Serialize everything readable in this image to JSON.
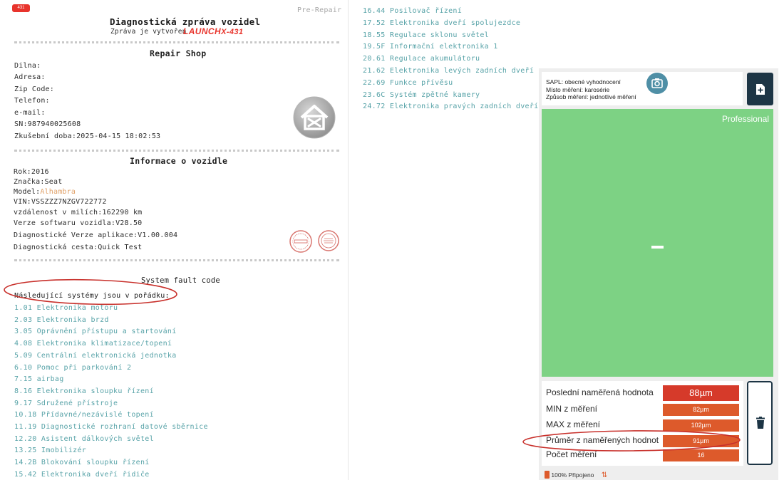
{
  "app_badge": "431",
  "report": {
    "pre_repair": "Pre-Repair",
    "title": "Diagnostická zpráva vozidel",
    "subtitle": "Zpráva je vytvořen",
    "brand_launch": "LAUNCH",
    "brand_x431": "X-431",
    "shop": {
      "heading": "Repair Shop",
      "dilna": "Dilna:",
      "adresa": "Adresa:",
      "zip": "Zip Code:",
      "telefon": "Telefon:",
      "email": "e-mail:",
      "sn": "SN:987940025608",
      "test_time": "Zkušební doba:2025-04-15 18:02:53"
    },
    "vehicle": {
      "heading": "Informace o vozidle",
      "year": "Rok:2016",
      "make": "Značka:Seat",
      "model_label": "Model:",
      "model_value": "Alhambra",
      "vin": "VIN:VSSZZZ7NZGV722772",
      "mileage": "vzdálenost v milích:162290 km",
      "sw_version": "Verze softwaru vozidla:V28.50",
      "app_version": "Diagnostické Verze aplikace:V1.00.004",
      "path": "Diagnostická cesta:Quick Test"
    },
    "fault": {
      "heading": "System fault code",
      "ok_text": "Následující systémy jsou v pořádku:",
      "systems_left": [
        "1.01 Elektronika motoru",
        "2.03 Elektronika brzd",
        "3.05 Oprávnění přístupu a startování",
        "4.08 Elektronika klimatizace/topení",
        "5.09 Centrální elektronická jednotka",
        "6.10 Pomoc při parkování 2",
        "7.15 airbag",
        "8.16 Elektronika sloupku řízení",
        "9.17 Sdružené přístroje",
        "10.18 Přídavné/nezávislé topení",
        "11.19 Diagnostické rozhraní datové sběrnice",
        "12.20 Asistent dálkových světel",
        "13.25 Imobilizér",
        "14.2B Blokování sloupku řízení",
        "15.42 Elektronika dveří řidiče"
      ],
      "systems_right": [
        "16.44 Posilovač řízení",
        "17.52 Elektronika dveří spolujezdce",
        "18.55 Regulace sklonu světel",
        "19.5F Informační elektronika 1",
        "20.61 Regulace akumulátoru",
        "21.62 Elektronika levých zadních dveří",
        "22.69 Funkce přívěsu",
        "23.6C Systém zpětné kamery",
        "24.72 Elektronika pravých zadních dveří"
      ]
    }
  },
  "gauge": {
    "info": {
      "sapl": "SAPL: obecné vyhodnocení",
      "location": "Místo měření: karosérie",
      "method": "Způsob měření: jednotlivé měření"
    },
    "mode": "Professional",
    "display_value": "-",
    "results": [
      {
        "label": "Poslední naměřená hodnota",
        "value": "88µm"
      },
      {
        "label": "MIN z měření",
        "value": "82µm"
      },
      {
        "label": "MAX z měření",
        "value": "102µm"
      },
      {
        "label": "Průměr z naměřených hodnot",
        "value": "91µm"
      },
      {
        "label": "Počet měření",
        "value": "16"
      }
    ],
    "status": {
      "battery": "100%",
      "connection": "Připojeno"
    },
    "colors": {
      "display_green": "#7dd284",
      "value_orange": "#dd5a2b",
      "value_red": "#d63a2a",
      "dark_navy": "#1d3545",
      "camera_blue": "#4f8fa6",
      "annotation_red": "#c8302b"
    }
  }
}
